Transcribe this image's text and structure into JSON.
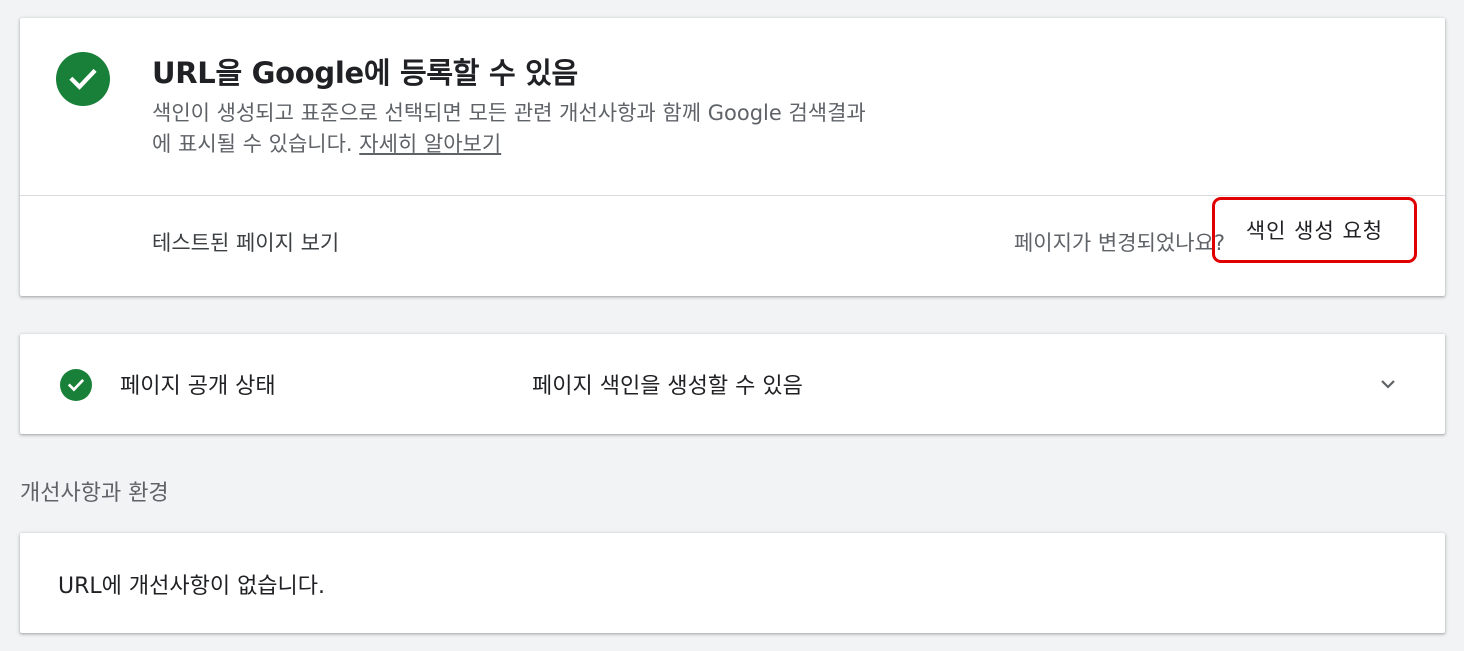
{
  "status": {
    "title": "URL을 Google에 등록할 수 있음",
    "description_line1": "색인이 생성되고 표준으로 선택되면 모든 관련 개선사항과 함께 Google 검색결과",
    "description_line2": "에 표시될 수 있습니다. ",
    "learn_more": "자세히 알아보기",
    "view_tested_page": "테스트된 페이지 보기",
    "page_changed_question": "페이지가 변경되었나요?",
    "request_indexing": "색인 생성 요청",
    "check_icon": "check-circle-icon",
    "accent_color": "#188038",
    "highlight_color": "#e00000"
  },
  "availability": {
    "label": "페이지 공개 상태",
    "value": "페이지 색인을 생성할 수 있음",
    "check_icon": "check-circle-icon",
    "expand_icon": "chevron-down-icon"
  },
  "enhancements": {
    "heading": "개선사항과 환경",
    "message": "URL에 개선사항이 없습니다."
  }
}
